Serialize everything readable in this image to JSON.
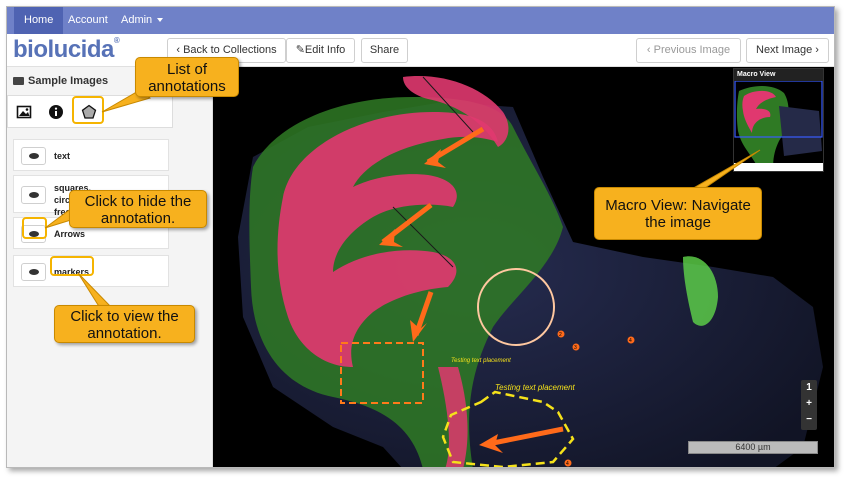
{
  "nav": {
    "home": "Home",
    "account": "Account",
    "admin": "Admin"
  },
  "brand": {
    "logo": "biolucida",
    "reg": "®"
  },
  "toolbar": {
    "back": "Back to Collections",
    "edit": "Edit Info",
    "share": "Share",
    "prev": "Previous Image",
    "next": "Next Image"
  },
  "sidebar": {
    "title": "Sample Images",
    "annotations": [
      {
        "label": "text"
      },
      {
        "label": "squares, circles, freehand"
      },
      {
        "label": "Arrows"
      },
      {
        "label": "markers"
      }
    ]
  },
  "viewer": {
    "macro_title": "Macro View",
    "zoom": {
      "level": "1",
      "plus": "+",
      "minus": "−"
    },
    "scale": "6400 µm",
    "text_small": "Testing text placement",
    "text_large": "Testing text placement",
    "markers": [
      "2",
      "3",
      "4",
      "4"
    ]
  },
  "callouts": {
    "list": "List of annotations",
    "hide": "Click to hide the annotation.",
    "view": "Click to view the annotation.",
    "macro": "Macro View: Navigate the image"
  },
  "colors": {
    "navbar": "#6f81c8",
    "accent": "#f7b11e",
    "brand": "#5772b7",
    "tissue_pink": "#e0386f",
    "tissue_green": "#3f9a2a"
  }
}
